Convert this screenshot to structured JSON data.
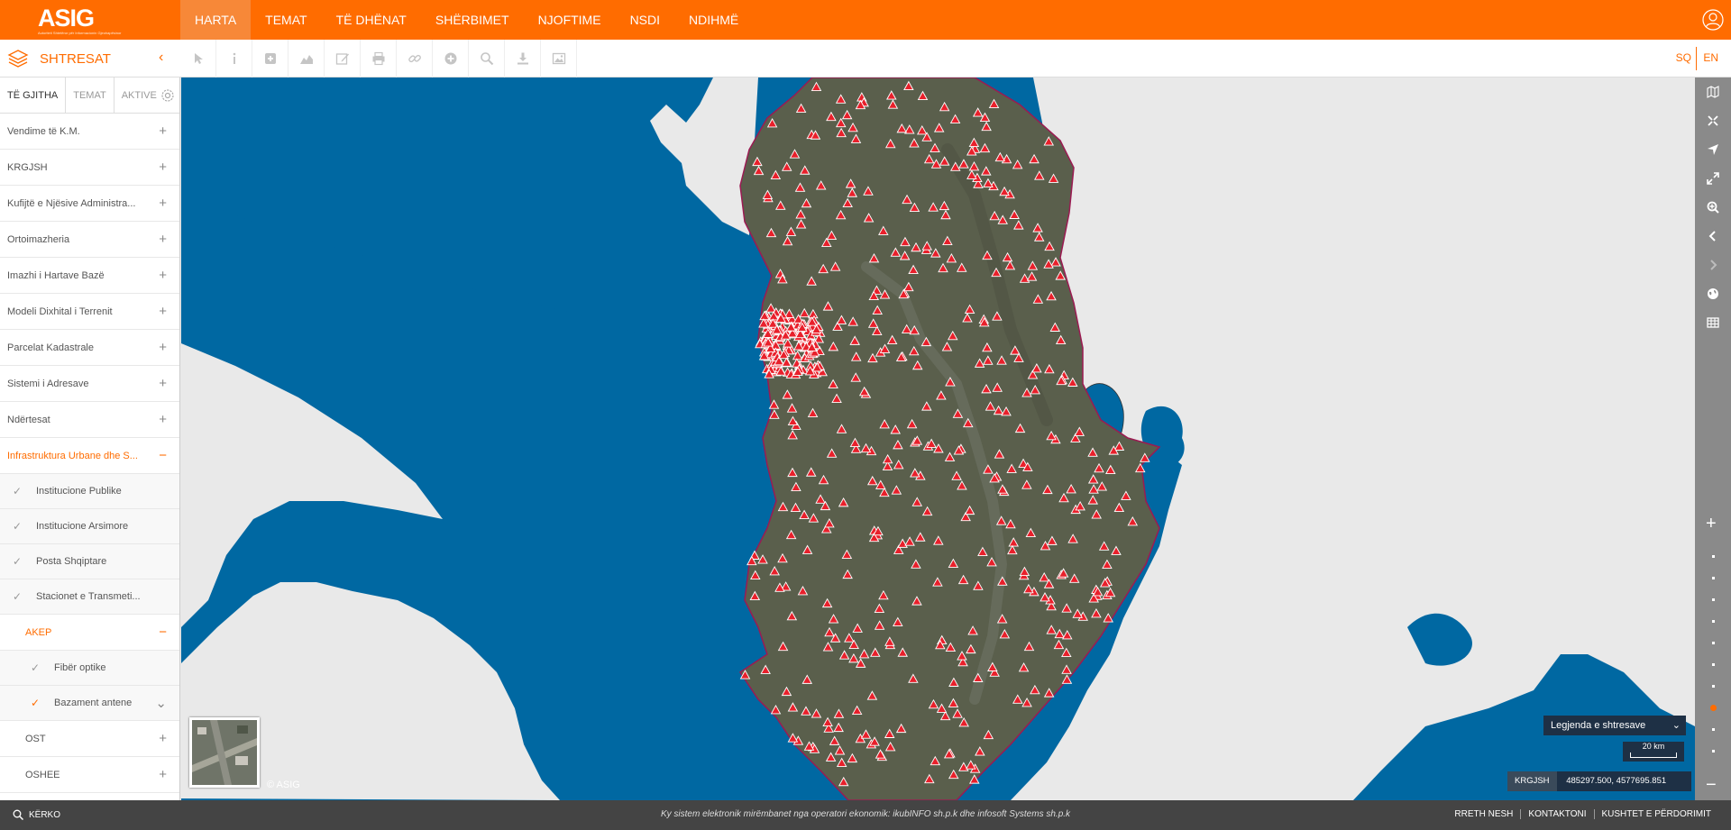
{
  "brand": {
    "logo_text": "ASIG",
    "logo_subtext": "Autoriteti Shtetëror për Informacionin Gjeohapësinor"
  },
  "nav": {
    "items": [
      "HARTA",
      "TEMAT",
      "TË DHËNAT",
      "SHËRBIMET",
      "NJOFTIME",
      "NSDI",
      "NDIHMË"
    ],
    "active": "HARTA"
  },
  "toolbar": {
    "panel_title": "SHTRESAT",
    "tool_icons": [
      "pointer-icon",
      "info-icon",
      "add-layer-icon",
      "profile-chart-icon",
      "edit-icon",
      "print-icon",
      "link-icon",
      "add-icon",
      "search-icon",
      "download-icon",
      "image-icon"
    ],
    "lang_sq": "SQ",
    "lang_en": "EN"
  },
  "sidebar": {
    "tabs": [
      "TË GJITHA",
      "TEMAT",
      "AKTIVE"
    ],
    "layers": [
      {
        "label": "Vendime të K.M.",
        "state": "+"
      },
      {
        "label": "KRGJSH",
        "state": "+"
      },
      {
        "label": "Kufijtë e Njësive Administra...",
        "state": "+"
      },
      {
        "label": "Ortoimazheria",
        "state": "+"
      },
      {
        "label": "Imazhi i Hartave Bazë",
        "state": "+"
      },
      {
        "label": "Modeli Dixhital i Terrenit",
        "state": "+"
      },
      {
        "label": "Parcelat Kadastrale",
        "state": "+"
      },
      {
        "label": "Sistemi i Adresave",
        "state": "+"
      },
      {
        "label": "Ndërtesat",
        "state": "+"
      }
    ],
    "open_group": {
      "label": "Infrastruktura Urbane dhe S...",
      "state": "−"
    },
    "sub_layers": [
      {
        "label": "Institucione Publike",
        "check": "✓"
      },
      {
        "label": "Institucione Arsimore",
        "check": "✓"
      },
      {
        "label": "Posta Shqiptare",
        "check": "✓"
      },
      {
        "label": "Stacionet e Transmeti...",
        "check": "✓"
      }
    ],
    "akep_group": {
      "label": "AKEP",
      "state": "−"
    },
    "akep_layers": [
      {
        "label": "Fibër optike",
        "check": "✓",
        "extra": ""
      },
      {
        "label": "Bazament antene",
        "check": "✓",
        "extra": "⌄"
      }
    ],
    "more_groups": [
      {
        "label": "OST",
        "state": "+"
      },
      {
        "label": "OSHEE",
        "state": "+"
      }
    ]
  },
  "map": {
    "copyright": "© ASIG",
    "colors": {
      "sea": "#0068a2",
      "land": "#e9e9e9",
      "albania": "#5a5f4c",
      "marker": "#e8202b",
      "accent": "#ff6c00"
    }
  },
  "controls": {
    "right_icons": [
      "map-icon",
      "fullscreen-icon",
      "locate-icon",
      "expand-icon",
      "zoom-area-icon",
      "back-icon",
      "forward-icon",
      "globe-icon",
      "table-icon"
    ],
    "zoom_level": 7,
    "zoom_levels": 10
  },
  "legend": {
    "label": "Legjenda e shtresave",
    "chevron": "⌄"
  },
  "scale": {
    "label": "20 km"
  },
  "coords": {
    "system": "KRGJSH",
    "value": "485297.500, 4577695.851"
  },
  "footer": {
    "search": "KËRKO",
    "note": "Ky sistem elektronik mirëmbanet nga operatori ekonomik: ikubINFO sh.p.k dhe infosoft Systems sh.p.k",
    "links": [
      "RRETH NESH",
      "KONTAKTONI",
      "KUSHTET E PËRDORIMIT"
    ]
  }
}
